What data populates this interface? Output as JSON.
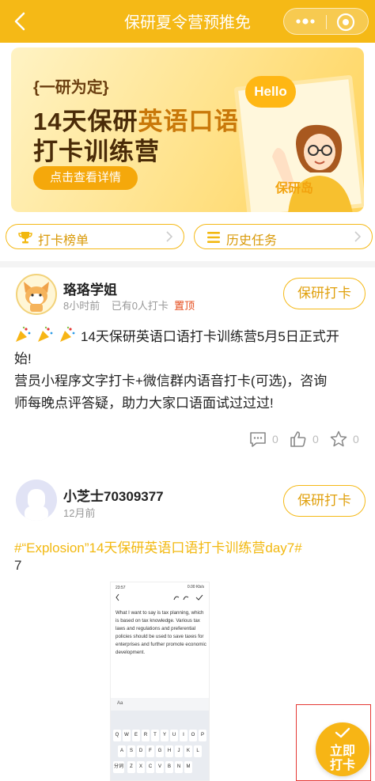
{
  "header": {
    "title": "保研夏令营预推免",
    "bg_color": "#f5b916"
  },
  "banner": {
    "subtitle": "{一研为定}",
    "title_line1_a": "14天保研",
    "title_line1_b": "英语口语",
    "title_line2": "打卡训练营",
    "cta": "点击查看详情",
    "bubble": "Hello",
    "brand": "保研岛"
  },
  "quick_links": [
    {
      "label": "打卡榜单",
      "icon": "trophy-icon"
    },
    {
      "label": "历史任务",
      "icon": "list-icon"
    }
  ],
  "posts": [
    {
      "author": "珞珞学姐",
      "time": "8小时前",
      "checkins": "已有0人打卡",
      "pinned": "置顶",
      "button": "保研打卡",
      "line1": "14天保研英语口语打卡训练营5月5日正式开",
      "line2": "始!",
      "line3": "营员小程序文字打卡+微信群内语音打卡(可选)，咨询",
      "line4": "师每晚点评答疑，助力大家口语面试过过过!",
      "comments": "0",
      "likes": "0",
      "favorites": "0"
    },
    {
      "author": "小芝士70309377",
      "time": "12月前",
      "button": "保研打卡",
      "title": "#“Explosion”14天保研英语口语打卡训练营day7#",
      "day": "7",
      "screenshot": {
        "time": "23:57",
        "status": "0.00 Kb/s",
        "text": "What I want to say is tax planning, which is based on tax knowledge. Various tax laws and regulations and preferential policies should be used to save taxes for enterprises and further promote economic development.",
        "tool_label": "Aa",
        "row1": [
          "Q",
          "W",
          "E",
          "R",
          "T",
          "Y",
          "U",
          "I",
          "O",
          "P"
        ],
        "row2": [
          "A",
          "S",
          "D",
          "F",
          "G",
          "H",
          "J",
          "K",
          "L"
        ],
        "row3_left": "分词",
        "row3": [
          "Z",
          "X",
          "C",
          "V",
          "B",
          "N",
          "M"
        ]
      }
    }
  ],
  "float_button": {
    "line1": "立即",
    "line2": "打卡"
  }
}
